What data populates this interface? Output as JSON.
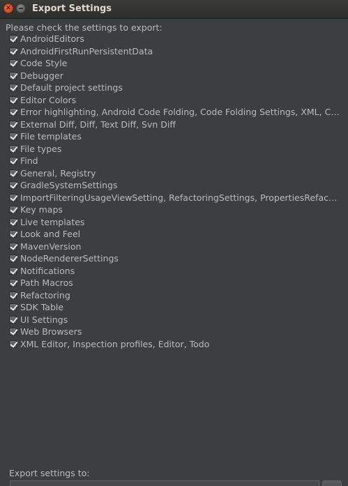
{
  "window": {
    "title": "Export Settings"
  },
  "prompt": "Please check the settings to export:",
  "settings": [
    {
      "label": "AndroidEditors",
      "checked": true
    },
    {
      "label": "AndroidFirstRunPersistentData",
      "checked": true
    },
    {
      "label": "Code Style",
      "checked": true
    },
    {
      "label": "Debugger",
      "checked": true
    },
    {
      "label": "Default project settings",
      "checked": true
    },
    {
      "label": "Editor Colors",
      "checked": true
    },
    {
      "label": "Error highlighting, Android Code Folding, Code Folding Settings, XML, Cod…",
      "checked": true
    },
    {
      "label": "External Diff, Diff, Text Diff, Svn Diff",
      "checked": true
    },
    {
      "label": "File templates",
      "checked": true
    },
    {
      "label": "File types",
      "checked": true
    },
    {
      "label": "Find",
      "checked": true
    },
    {
      "label": "General, Registry",
      "checked": true
    },
    {
      "label": "GradleSystemSettings",
      "checked": true
    },
    {
      "label": "ImportFilteringUsageViewSetting, RefactoringSettings, PropertiesRefact…",
      "checked": true
    },
    {
      "label": "Key maps",
      "checked": true
    },
    {
      "label": "Live templates",
      "checked": true
    },
    {
      "label": "Look and Feel",
      "checked": true
    },
    {
      "label": "MavenVersion",
      "checked": true
    },
    {
      "label": "NodeRendererSettings",
      "checked": true
    },
    {
      "label": "Notifications",
      "checked": true
    },
    {
      "label": "Path Macros",
      "checked": true
    },
    {
      "label": "Refactoring",
      "checked": true
    },
    {
      "label": "SDK Table",
      "checked": true
    },
    {
      "label": "UI Settings",
      "checked": true
    },
    {
      "label": "Web Browsers",
      "checked": true
    },
    {
      "label": "XML Editor, Inspection profiles, Editor, Todo",
      "checked": true
    }
  ],
  "export": {
    "label": "Export settings to:",
    "path_value": ""
  },
  "colors": {
    "background": "#3c3f41",
    "text": "#bbbbbb",
    "close_button": "#e05a2b"
  }
}
